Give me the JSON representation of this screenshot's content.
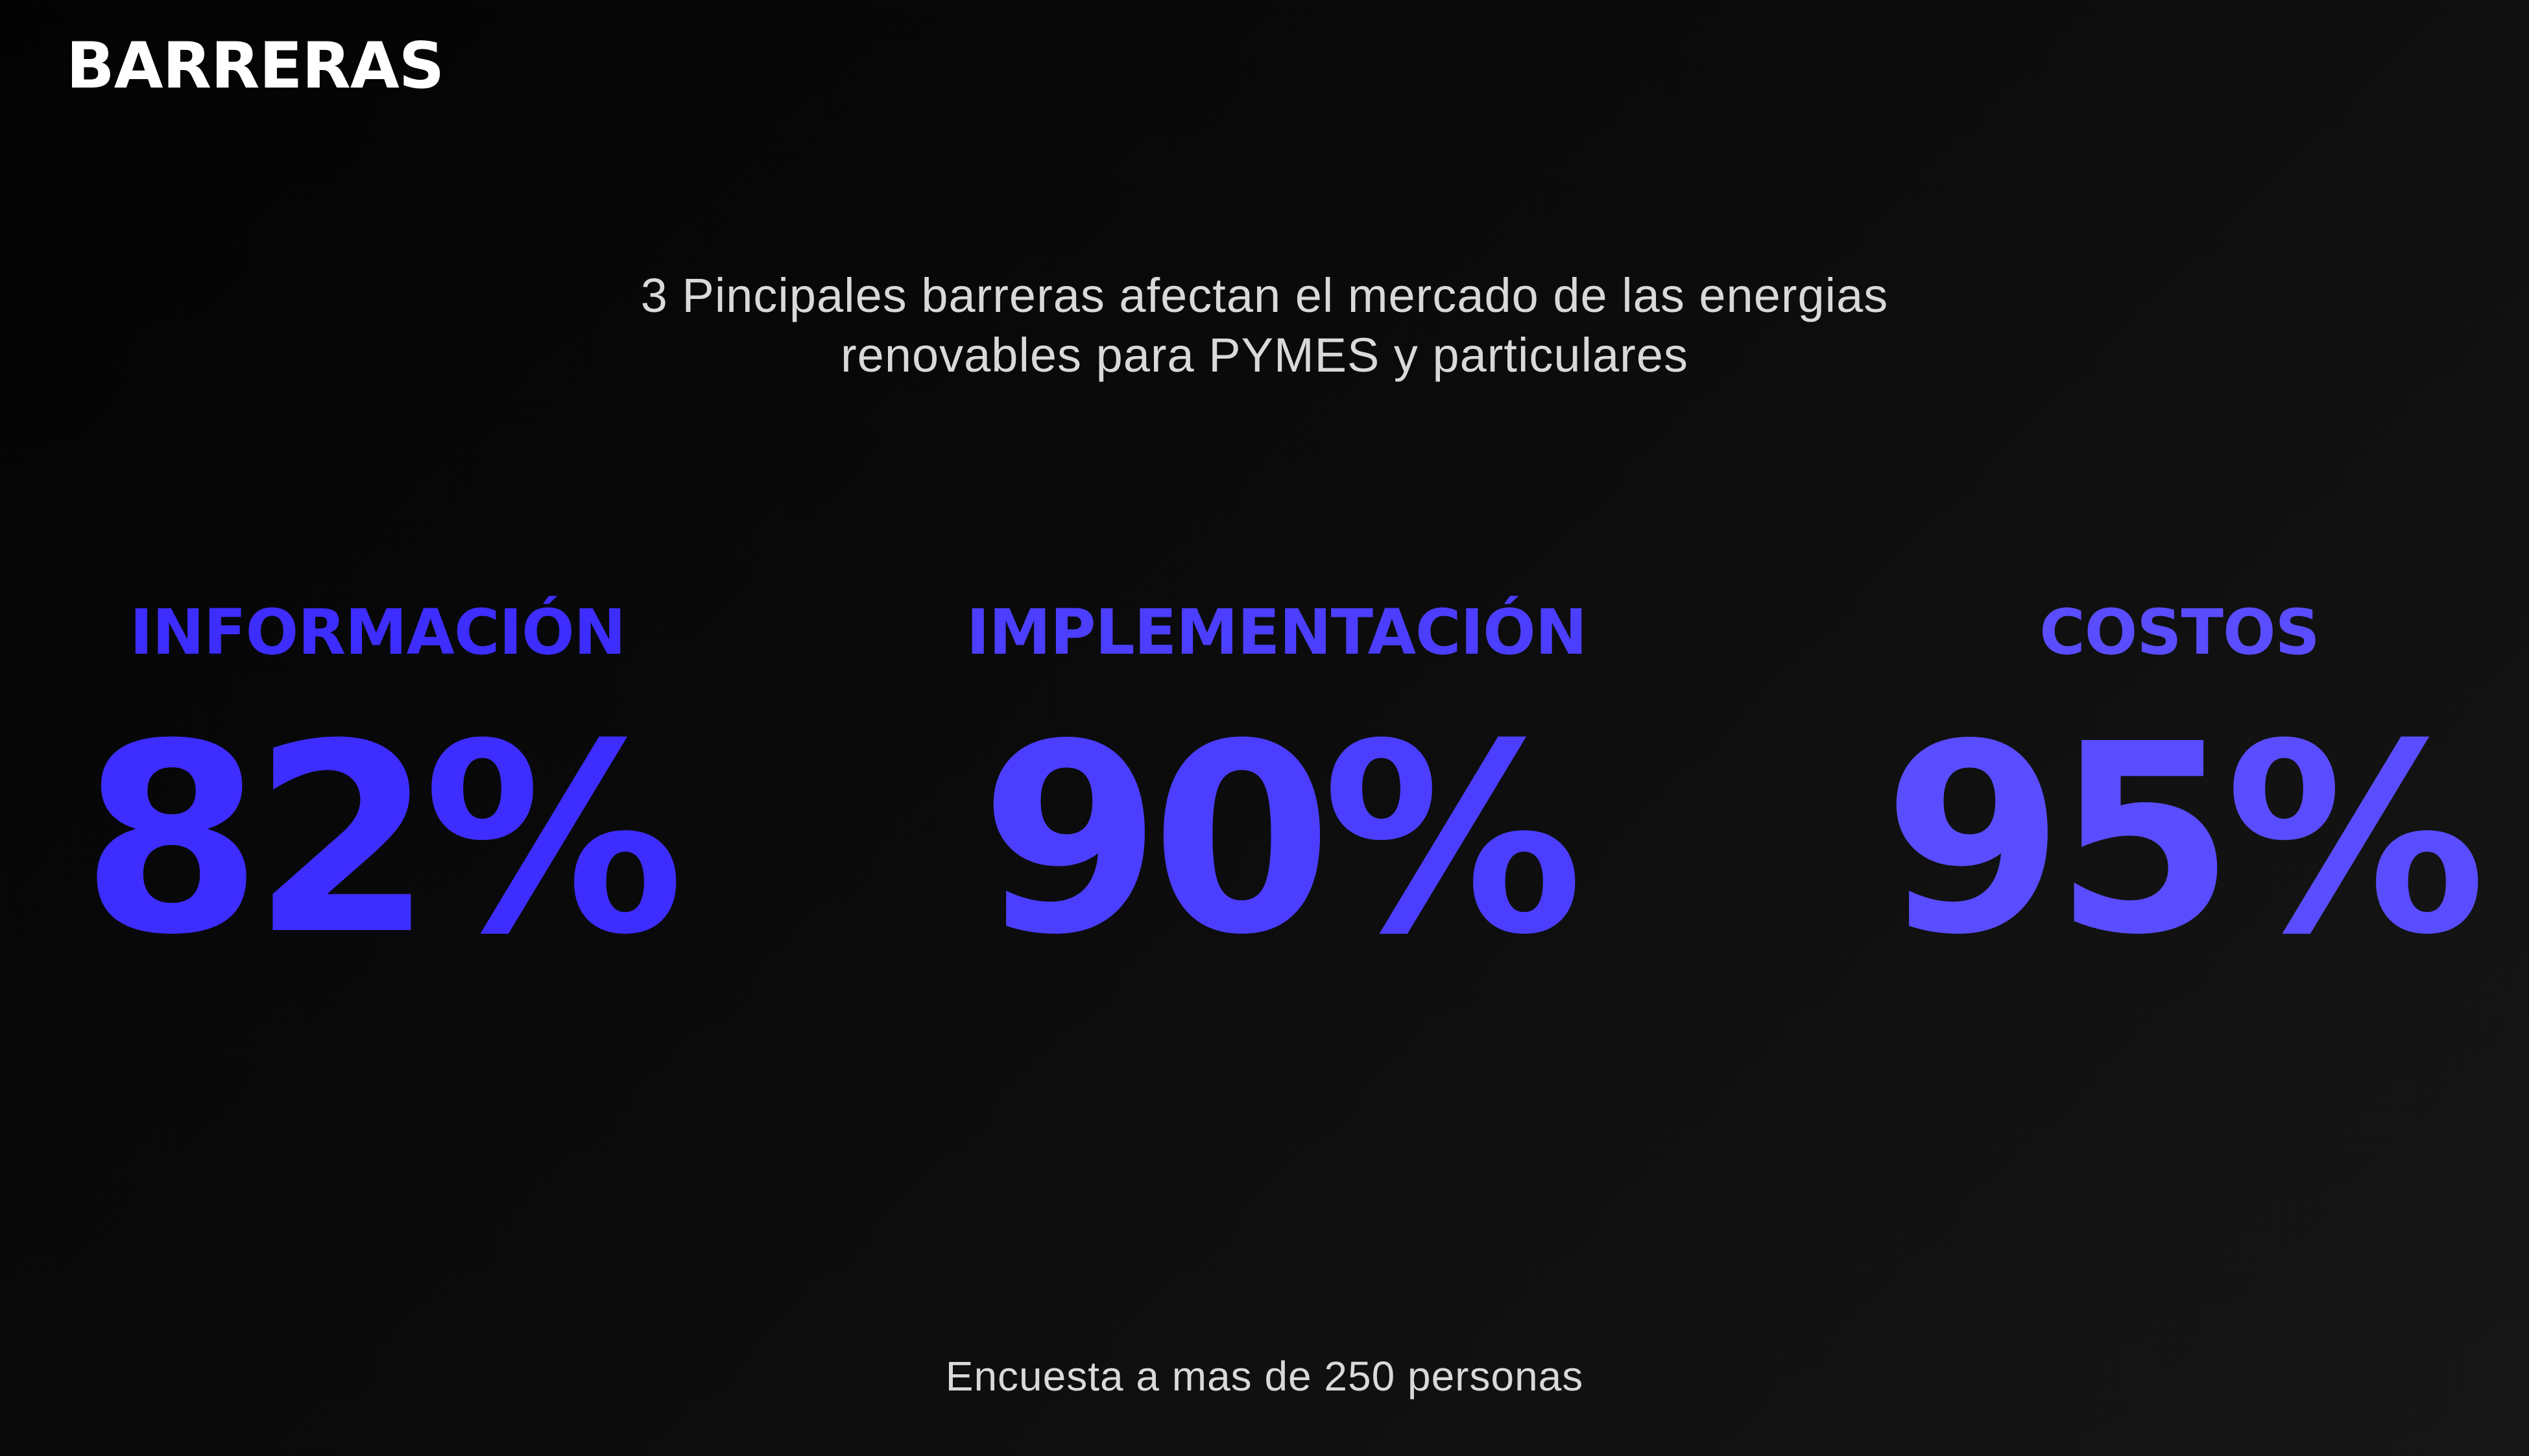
{
  "slide": {
    "title": "BARRERAS",
    "subtitle": {
      "line1": "3 Pincipales barreras afectan el mercado de las energias",
      "line2": "renovables para PYMES y particulares"
    },
    "stats": [
      {
        "label": "INFORMACIÓN",
        "value": "82%",
        "color": "#3d2dff"
      },
      {
        "label": "IMPLEMENTACIÓN",
        "value": "90%",
        "color": "#4b3eff"
      },
      {
        "label": "COSTOS",
        "value": "95%",
        "color": "#5a4dff"
      }
    ],
    "footer": "Encuesta  a mas de 250 personas"
  }
}
